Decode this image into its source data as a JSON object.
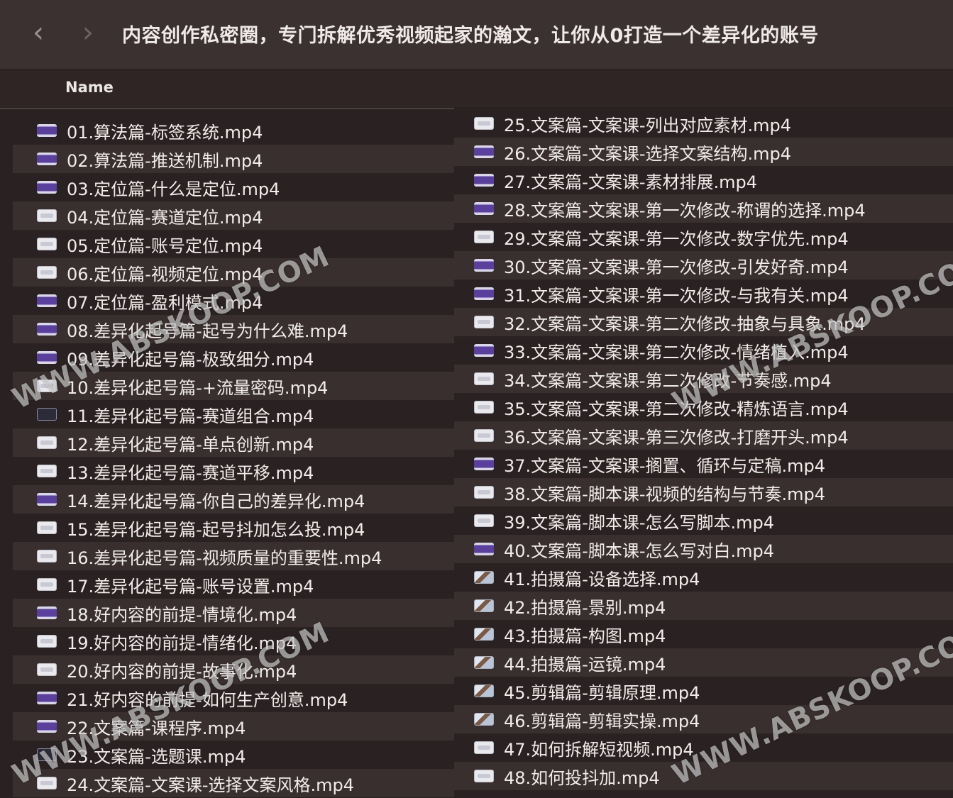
{
  "window": {
    "title": "内容创作私密圈，专门拆解优秀视频起家的瀚文，让你从0打造一个差异化的账号",
    "back_icon": "chevron-left-icon",
    "forward_icon": "chevron-right-icon"
  },
  "list_header": {
    "name": "Name"
  },
  "files_left": [
    {
      "name": "01.算法篇-标签系统.mp4",
      "icon": "purple"
    },
    {
      "name": "02.算法篇-推送机制.mp4",
      "icon": "purple"
    },
    {
      "name": "03.定位篇-什么是定位.mp4",
      "icon": "purple"
    },
    {
      "name": "04.定位篇-赛道定位.mp4",
      "icon": "white"
    },
    {
      "name": "05.定位篇-账号定位.mp4",
      "icon": "white"
    },
    {
      "name": "06.定位篇-视频定位.mp4",
      "icon": "white"
    },
    {
      "name": "07.定位篇-盈利模式.mp4",
      "icon": "purple"
    },
    {
      "name": "08.差异化起号篇-起号为什么难.mp4",
      "icon": "purple"
    },
    {
      "name": "09.差异化起号篇-极致细分.mp4",
      "icon": "purple"
    },
    {
      "name": "10.差异化起号篇-+流量密码.mp4",
      "icon": "white"
    },
    {
      "name": "11.差异化起号篇-赛道组合.mp4",
      "icon": "video"
    },
    {
      "name": "12.差异化起号篇-单点创新.mp4",
      "icon": "white"
    },
    {
      "name": "13.差异化起号篇-赛道平移.mp4",
      "icon": "white"
    },
    {
      "name": "14.差异化起号篇-你自己的差异化.mp4",
      "icon": "purple"
    },
    {
      "name": "15.差异化起号篇-起号抖加怎么投.mp4",
      "icon": "white"
    },
    {
      "name": "16.差异化起号篇-视频质量的重要性.mp4",
      "icon": "white"
    },
    {
      "name": "17.差异化起号篇-账号设置.mp4",
      "icon": "white"
    },
    {
      "name": "18.好内容的前提-情境化.mp4",
      "icon": "purple"
    },
    {
      "name": "19.好内容的前提-情绪化.mp4",
      "icon": "white"
    },
    {
      "name": "20.好内容的前提-故事化.mp4",
      "icon": "white"
    },
    {
      "name": "21.好内容的前提-如何生产创意.mp4",
      "icon": "purple"
    },
    {
      "name": "22.文案篇-课程序.mp4",
      "icon": "purple"
    },
    {
      "name": "23.文案篇-选题课.mp4",
      "icon": "video"
    },
    {
      "name": "24.文案篇-文案课-选择文案风格.mp4",
      "icon": "white"
    }
  ],
  "files_right": [
    {
      "name": "25.文案篇-文案课-列出对应素材.mp4",
      "icon": "white"
    },
    {
      "name": "26.文案篇-文案课-选择文案结构.mp4",
      "icon": "purple"
    },
    {
      "name": "27.文案篇-文案课-素材排展.mp4",
      "icon": "purple"
    },
    {
      "name": "28.文案篇-文案课-第一次修改-称谓的选择.mp4",
      "icon": "purple"
    },
    {
      "name": "29.文案篇-文案课-第一次修改-数字优先.mp4",
      "icon": "white"
    },
    {
      "name": "30.文案篇-文案课-第一次修改-引发好奇.mp4",
      "icon": "purple"
    },
    {
      "name": "31.文案篇-文案课-第一次修改-与我有关.mp4",
      "icon": "purple"
    },
    {
      "name": "32.文案篇-文案课-第二次修改-抽象与具象.mp4",
      "icon": "white"
    },
    {
      "name": "33.文案篇-文案课-第二次修改-情绪植入.mp4",
      "icon": "purple"
    },
    {
      "name": "34.文案篇-文案课-第二次修改-节奏感.mp4",
      "icon": "white"
    },
    {
      "name": "35.文案篇-文案课-第二次修改-精炼语言.mp4",
      "icon": "white"
    },
    {
      "name": "36.文案篇-文案课-第三次修改-打磨开头.mp4",
      "icon": "white"
    },
    {
      "name": "37.文案篇-文案课-搁置、循环与定稿.mp4",
      "icon": "purple"
    },
    {
      "name": "38.文案篇-脚本课-视频的结构与节奏.mp4",
      "icon": "white"
    },
    {
      "name": "39.文案篇-脚本课-怎么写脚本.mp4",
      "icon": "white"
    },
    {
      "name": "40.文案篇-脚本课-怎么写对白.mp4",
      "icon": "purple"
    },
    {
      "name": "41.拍摄篇-设备选择.mp4",
      "icon": "photo"
    },
    {
      "name": "42.拍摄篇-景别.mp4",
      "icon": "photo"
    },
    {
      "name": "43.拍摄篇-构图.mp4",
      "icon": "photo"
    },
    {
      "name": "44.拍摄篇-运镜.mp4",
      "icon": "photo"
    },
    {
      "name": "45.剪辑篇-剪辑原理.mp4",
      "icon": "photo"
    },
    {
      "name": "46.剪辑篇-剪辑实操.mp4",
      "icon": "photo"
    },
    {
      "name": "47.如何拆解短视频.mp4",
      "icon": "white"
    },
    {
      "name": "48.如何投抖加.mp4",
      "icon": "white"
    }
  ],
  "watermarks": [
    "WWW.ABSKOOP.COM",
    "WWW.ABSKOOP.COM",
    "WWW.ABSKOOP.COM",
    "WWW.ABSKOOP.COM"
  ]
}
